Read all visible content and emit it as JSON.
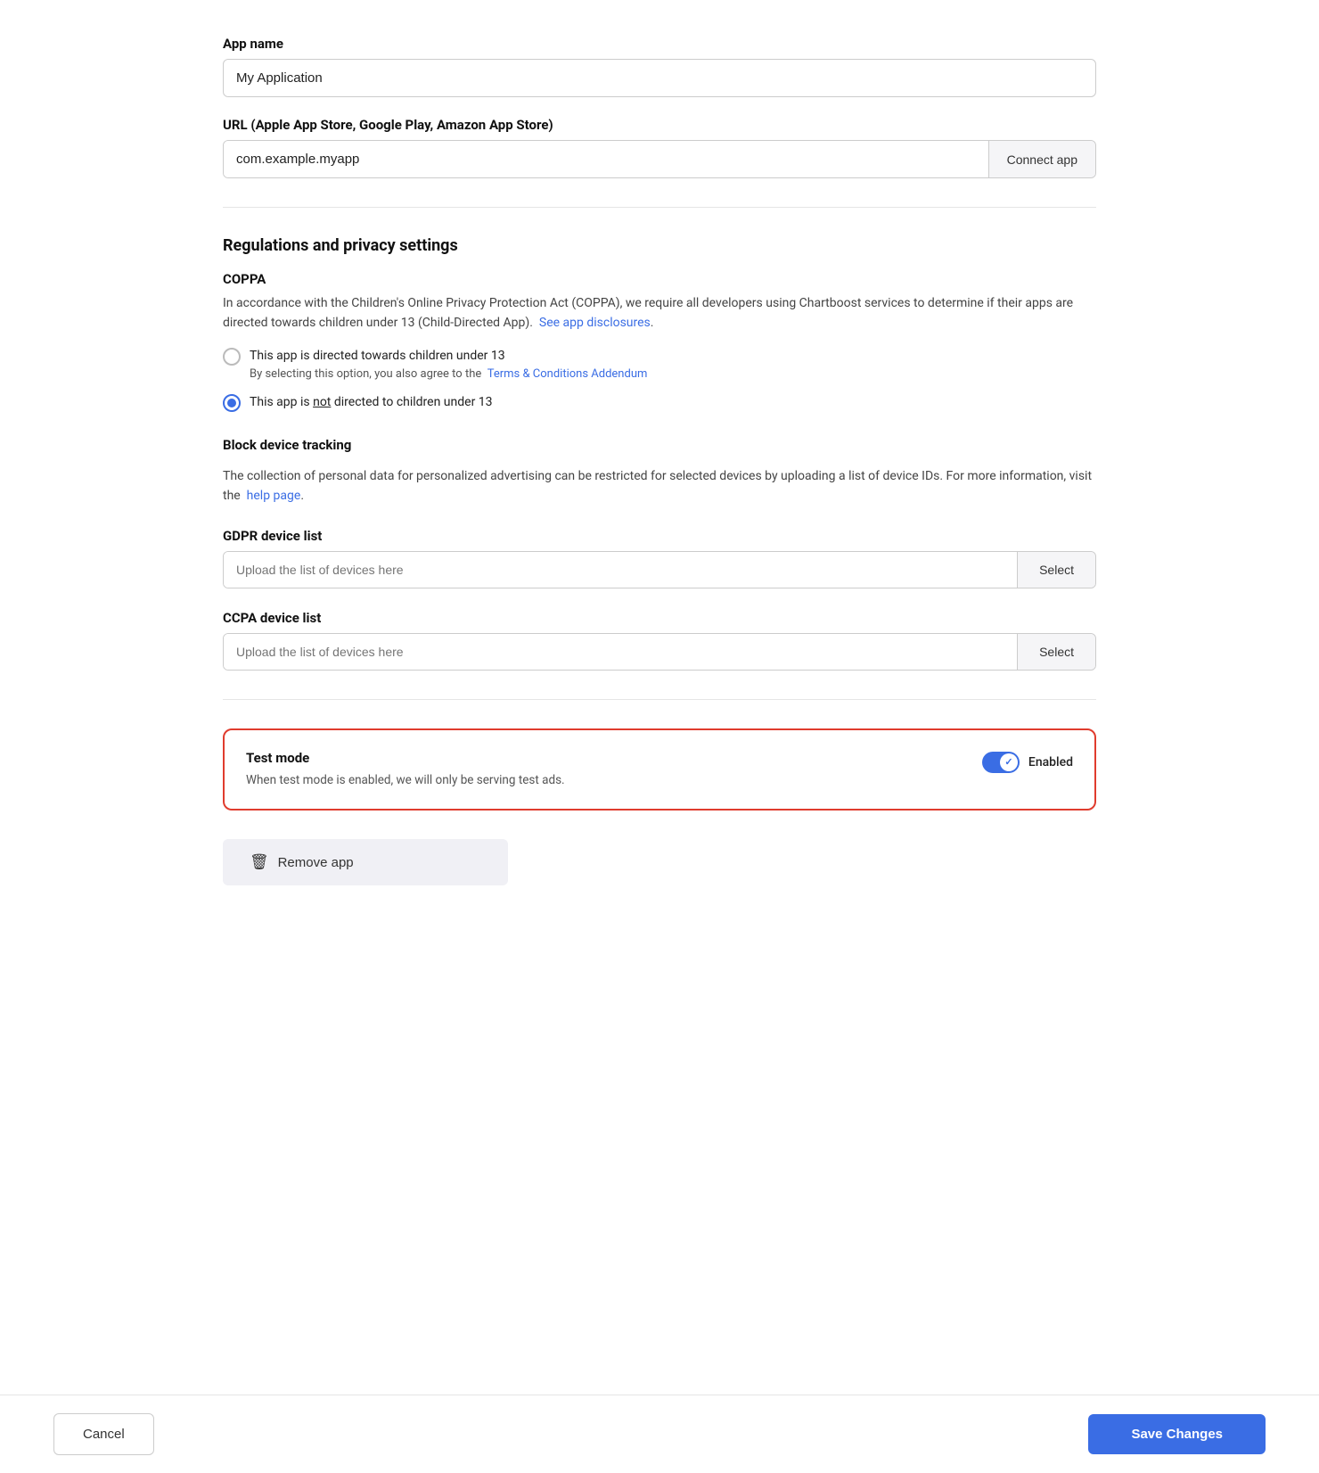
{
  "app_name": {
    "label": "App name",
    "value": "My Application",
    "placeholder": "My Application"
  },
  "url": {
    "label": "URL (Apple App Store, Google Play, Amazon App Store)",
    "value": "com.example.myapp",
    "placeholder": "com.example.myapp",
    "connect_button": "Connect app"
  },
  "regulations": {
    "section_title": "Regulations and privacy settings",
    "coppa": {
      "title": "COPPA",
      "description_1": "In accordance with the Children's Online Privacy Protection Act (COPPA), we require all developers using Chartboost services to determine if their apps are directed towards children under 13 (Child-Directed App).",
      "see_app_disclosures_link": "See app disclosures",
      "radio_1_label": "This app is directed towards children under 13",
      "radio_1_sublabel": "By selecting this option, you also agree to the",
      "terms_link": "Terms & Conditions Addendum",
      "radio_2_label_before": "This app is",
      "radio_2_label_underline": "not",
      "radio_2_label_after": "directed to children under 13",
      "radio_1_checked": false,
      "radio_2_checked": true
    },
    "block_device": {
      "title": "Block device tracking",
      "description": "The collection of personal data for personalized advertising can be restricted for selected devices by uploading a list of device IDs. For more information, visit the",
      "help_link": "help page",
      "description_end": "."
    },
    "gdpr": {
      "label": "GDPR device list",
      "placeholder": "Upload the list of devices here",
      "select_button": "Select"
    },
    "ccpa": {
      "label": "CCPA device list",
      "placeholder": "Upload the list of devices here",
      "select_button": "Select"
    }
  },
  "test_mode": {
    "title": "Test mode",
    "description": "When test mode is enabled, we will only be serving test ads.",
    "toggle_label": "Enabled",
    "enabled": true
  },
  "remove_app": {
    "button_label": "Remove app"
  },
  "footer": {
    "cancel_label": "Cancel",
    "save_label": "Save Changes"
  },
  "icons": {
    "trash": "🗑",
    "check": "✓"
  }
}
